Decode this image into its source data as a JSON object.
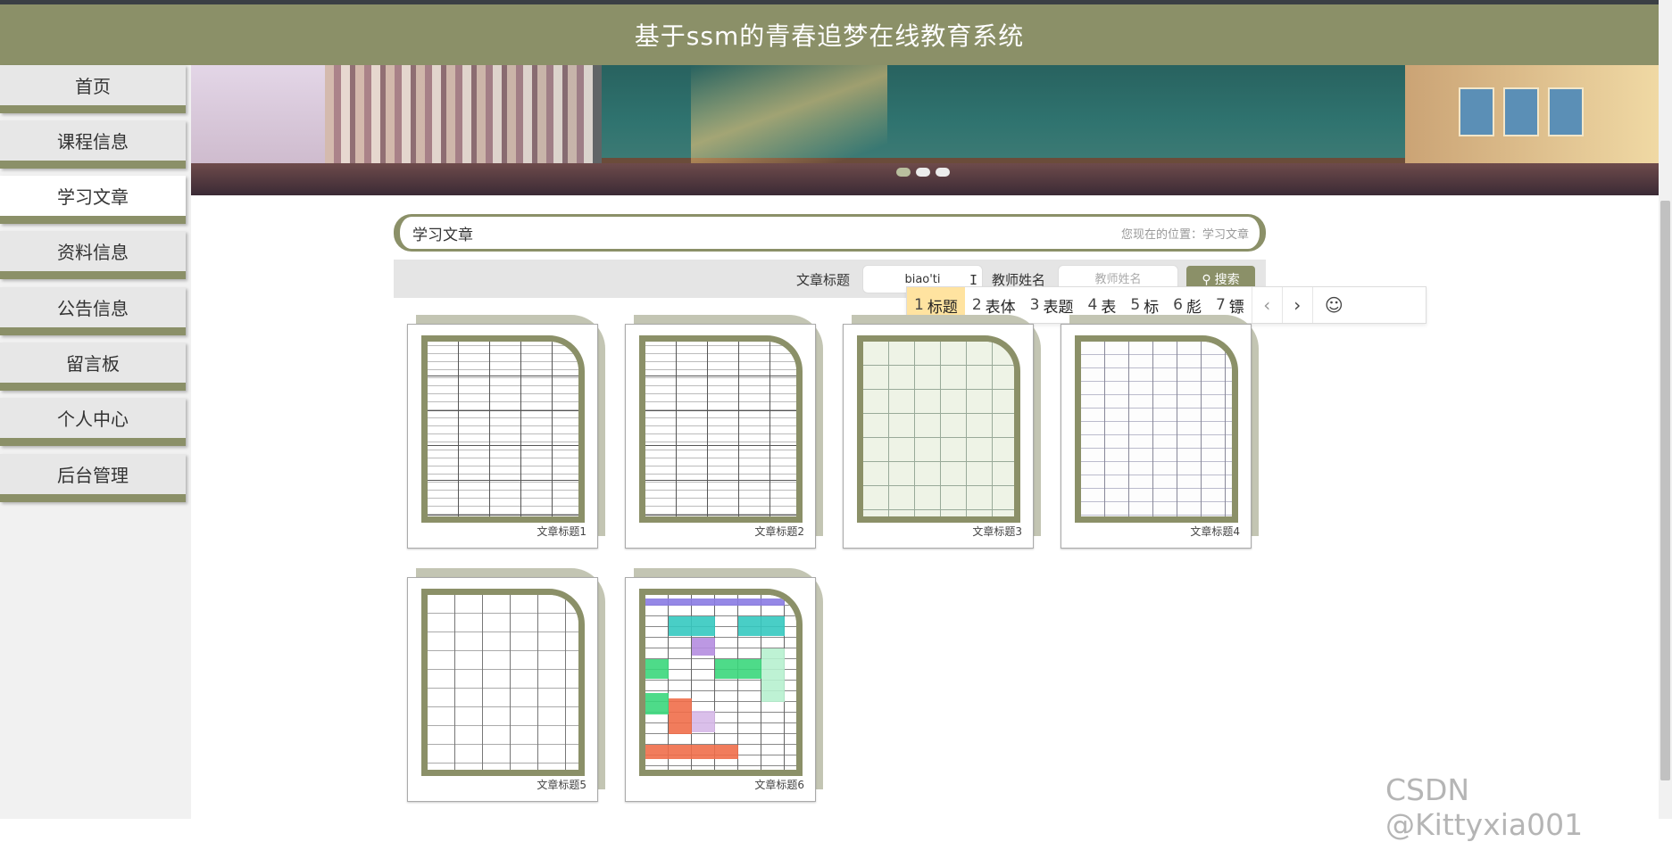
{
  "header": {
    "title": "基于ssm的青春追梦在线教育系统"
  },
  "sidebar": {
    "items": [
      {
        "label": "首页"
      },
      {
        "label": "课程信息"
      },
      {
        "label": "学习文章",
        "active": true
      },
      {
        "label": "资料信息"
      },
      {
        "label": "公告信息"
      },
      {
        "label": "留言板"
      },
      {
        "label": "个人中心"
      },
      {
        "label": "后台管理"
      }
    ]
  },
  "breadcrumb": {
    "title": "学习文章",
    "location": "您现在的位置：学习文章"
  },
  "search": {
    "title_label": "文章标题",
    "title_value": "biao'ti",
    "teacher_label": "教师姓名",
    "teacher_placeholder": "教师姓名",
    "button_label": "搜索"
  },
  "ime": {
    "candidates": [
      {
        "num": "1",
        "text": "标题"
      },
      {
        "num": "2",
        "text": "表体"
      },
      {
        "num": "3",
        "text": "表题"
      },
      {
        "num": "4",
        "text": "表"
      },
      {
        "num": "5",
        "text": "标"
      },
      {
        "num": "6",
        "text": "彪"
      },
      {
        "num": "7",
        "text": "镖"
      }
    ],
    "prev": "‹",
    "next": "›",
    "emoji": "☺"
  },
  "articles": [
    {
      "title": "文章标题1"
    },
    {
      "title": "文章标题2"
    },
    {
      "title": "文章标题3"
    },
    {
      "title": "文章标题4"
    },
    {
      "title": "文章标题5"
    },
    {
      "title": "文章标题6"
    }
  ],
  "colors": {
    "accent": "#8b9068",
    "ime_selected": "#ffe3a0"
  },
  "watermark": "CSDN @Kittyxia001"
}
